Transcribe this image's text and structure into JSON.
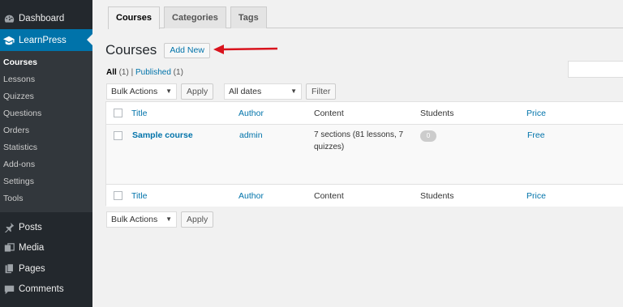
{
  "sidebar": {
    "dashboard": "Dashboard",
    "learnpress": "LearnPress",
    "submenu": [
      "Courses",
      "Lessons",
      "Quizzes",
      "Questions",
      "Orders",
      "Statistics",
      "Add-ons",
      "Settings",
      "Tools"
    ],
    "lower": [
      "Posts",
      "Media",
      "Pages",
      "Comments"
    ]
  },
  "tabs": [
    "Courses",
    "Categories",
    "Tags"
  ],
  "page": {
    "title": "Courses",
    "add_new": "Add New"
  },
  "filters": {
    "all": "All",
    "all_count": "(1)",
    "separator": "|",
    "published": "Published",
    "published_count": "(1)"
  },
  "controls": {
    "bulk_actions": "Bulk Actions",
    "apply": "Apply",
    "all_dates": "All dates",
    "filter": "Filter"
  },
  "table": {
    "columns": [
      "Title",
      "Author",
      "Content",
      "Students",
      "Price"
    ],
    "rows": [
      {
        "title": "Sample course",
        "author": "admin",
        "content_line1": "7 sections (81 lessons, 7",
        "content_line2": "quizzes)",
        "students": "0",
        "price": "Free"
      }
    ]
  },
  "colors": {
    "sidebar_bg": "#23282d",
    "accent": "#0073aa",
    "arrow": "#d9131d"
  }
}
